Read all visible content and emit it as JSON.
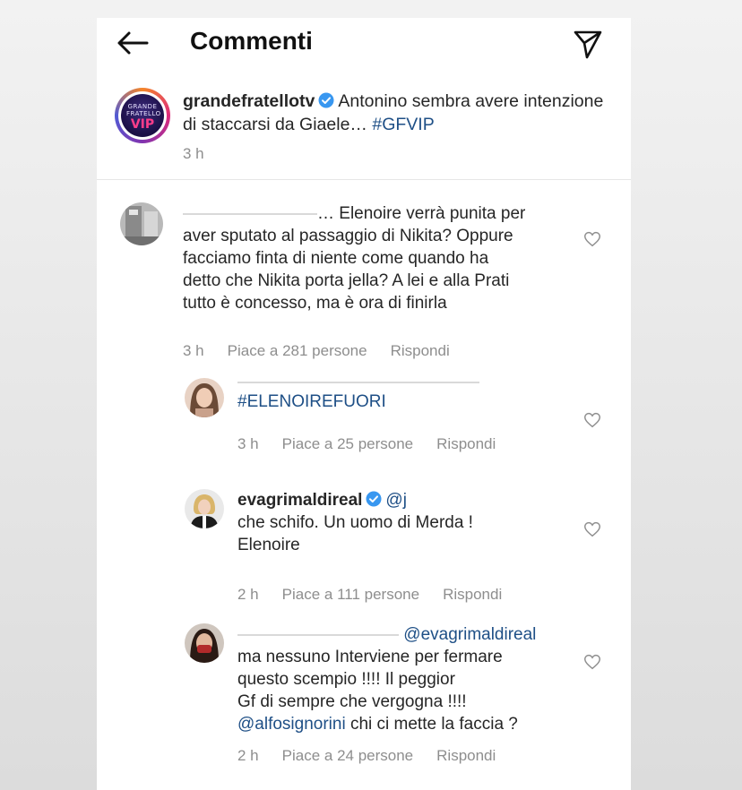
{
  "header": {
    "title": "Commenti"
  },
  "post": {
    "username": "grandefratellotv",
    "caption": "Antonino sembra avere intenzione di staccarsi da Giaele…",
    "hashtag": "#GFVIP",
    "time": "3 h",
    "avatar_logo_top": "GRANDE FRATELLO",
    "avatar_logo_bottom": "VIP"
  },
  "comments": [
    {
      "username_fragment": "…",
      "lines": [
        "Elenoire verrà punita per",
        "aver sputato al passaggio di Nikita? Oppure",
        "facciamo finta di niente come quando ha",
        "detto che Nikita porta jella? A lei e alla Prati",
        "tutto è concesso, ma è ora di finirla"
      ],
      "time": "3 h",
      "likes": "Piace a 281 persone",
      "reply": "Rispondi"
    },
    {
      "text": "#ELENOIREFUORI",
      "time": "3 h",
      "likes": "Piace a 25 persone",
      "reply": "Rispondi"
    },
    {
      "username": "evagrimaldireal",
      "mention": "@j",
      "lines": [
        "che schifo. Un uomo di Merda !",
        "Elenoire"
      ],
      "time": "2 h",
      "likes": "Piace a 111 persone",
      "reply": "Rispondi"
    },
    {
      "mention": "@evagrimaldireal",
      "lines": [
        "ma nessuno Interviene per fermare",
        "questo scempio !!!! Il peggior",
        "Gf di sempre che vergogna !!!!"
      ],
      "last_mention": "@alfosignorini",
      "last_text": " chi ci mette la faccia ?",
      "time": "2 h",
      "likes": "Piace a 24 persone",
      "reply": "Rispondi"
    }
  ]
}
